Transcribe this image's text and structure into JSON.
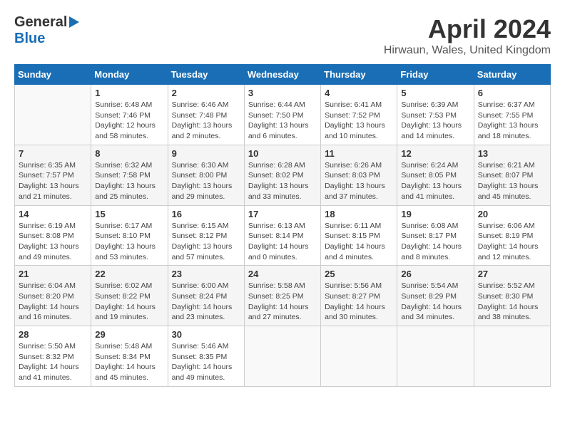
{
  "header": {
    "logo_general": "General",
    "logo_blue": "Blue",
    "month_title": "April 2024",
    "location": "Hirwaun, Wales, United Kingdom"
  },
  "days_of_week": [
    "Sunday",
    "Monday",
    "Tuesday",
    "Wednesday",
    "Thursday",
    "Friday",
    "Saturday"
  ],
  "weeks": [
    [
      {
        "day": "",
        "sunrise": "",
        "sunset": "",
        "daylight": ""
      },
      {
        "day": "1",
        "sunrise": "Sunrise: 6:48 AM",
        "sunset": "Sunset: 7:46 PM",
        "daylight": "Daylight: 12 hours and 58 minutes."
      },
      {
        "day": "2",
        "sunrise": "Sunrise: 6:46 AM",
        "sunset": "Sunset: 7:48 PM",
        "daylight": "Daylight: 13 hours and 2 minutes."
      },
      {
        "day": "3",
        "sunrise": "Sunrise: 6:44 AM",
        "sunset": "Sunset: 7:50 PM",
        "daylight": "Daylight: 13 hours and 6 minutes."
      },
      {
        "day": "4",
        "sunrise": "Sunrise: 6:41 AM",
        "sunset": "Sunset: 7:52 PM",
        "daylight": "Daylight: 13 hours and 10 minutes."
      },
      {
        "day": "5",
        "sunrise": "Sunrise: 6:39 AM",
        "sunset": "Sunset: 7:53 PM",
        "daylight": "Daylight: 13 hours and 14 minutes."
      },
      {
        "day": "6",
        "sunrise": "Sunrise: 6:37 AM",
        "sunset": "Sunset: 7:55 PM",
        "daylight": "Daylight: 13 hours and 18 minutes."
      }
    ],
    [
      {
        "day": "7",
        "sunrise": "Sunrise: 6:35 AM",
        "sunset": "Sunset: 7:57 PM",
        "daylight": "Daylight: 13 hours and 21 minutes."
      },
      {
        "day": "8",
        "sunrise": "Sunrise: 6:32 AM",
        "sunset": "Sunset: 7:58 PM",
        "daylight": "Daylight: 13 hours and 25 minutes."
      },
      {
        "day": "9",
        "sunrise": "Sunrise: 6:30 AM",
        "sunset": "Sunset: 8:00 PM",
        "daylight": "Daylight: 13 hours and 29 minutes."
      },
      {
        "day": "10",
        "sunrise": "Sunrise: 6:28 AM",
        "sunset": "Sunset: 8:02 PM",
        "daylight": "Daylight: 13 hours and 33 minutes."
      },
      {
        "day": "11",
        "sunrise": "Sunrise: 6:26 AM",
        "sunset": "Sunset: 8:03 PM",
        "daylight": "Daylight: 13 hours and 37 minutes."
      },
      {
        "day": "12",
        "sunrise": "Sunrise: 6:24 AM",
        "sunset": "Sunset: 8:05 PM",
        "daylight": "Daylight: 13 hours and 41 minutes."
      },
      {
        "day": "13",
        "sunrise": "Sunrise: 6:21 AM",
        "sunset": "Sunset: 8:07 PM",
        "daylight": "Daylight: 13 hours and 45 minutes."
      }
    ],
    [
      {
        "day": "14",
        "sunrise": "Sunrise: 6:19 AM",
        "sunset": "Sunset: 8:08 PM",
        "daylight": "Daylight: 13 hours and 49 minutes."
      },
      {
        "day": "15",
        "sunrise": "Sunrise: 6:17 AM",
        "sunset": "Sunset: 8:10 PM",
        "daylight": "Daylight: 13 hours and 53 minutes."
      },
      {
        "day": "16",
        "sunrise": "Sunrise: 6:15 AM",
        "sunset": "Sunset: 8:12 PM",
        "daylight": "Daylight: 13 hours and 57 minutes."
      },
      {
        "day": "17",
        "sunrise": "Sunrise: 6:13 AM",
        "sunset": "Sunset: 8:14 PM",
        "daylight": "Daylight: 14 hours and 0 minutes."
      },
      {
        "day": "18",
        "sunrise": "Sunrise: 6:11 AM",
        "sunset": "Sunset: 8:15 PM",
        "daylight": "Daylight: 14 hours and 4 minutes."
      },
      {
        "day": "19",
        "sunrise": "Sunrise: 6:08 AM",
        "sunset": "Sunset: 8:17 PM",
        "daylight": "Daylight: 14 hours and 8 minutes."
      },
      {
        "day": "20",
        "sunrise": "Sunrise: 6:06 AM",
        "sunset": "Sunset: 8:19 PM",
        "daylight": "Daylight: 14 hours and 12 minutes."
      }
    ],
    [
      {
        "day": "21",
        "sunrise": "Sunrise: 6:04 AM",
        "sunset": "Sunset: 8:20 PM",
        "daylight": "Daylight: 14 hours and 16 minutes."
      },
      {
        "day": "22",
        "sunrise": "Sunrise: 6:02 AM",
        "sunset": "Sunset: 8:22 PM",
        "daylight": "Daylight: 14 hours and 19 minutes."
      },
      {
        "day": "23",
        "sunrise": "Sunrise: 6:00 AM",
        "sunset": "Sunset: 8:24 PM",
        "daylight": "Daylight: 14 hours and 23 minutes."
      },
      {
        "day": "24",
        "sunrise": "Sunrise: 5:58 AM",
        "sunset": "Sunset: 8:25 PM",
        "daylight": "Daylight: 14 hours and 27 minutes."
      },
      {
        "day": "25",
        "sunrise": "Sunrise: 5:56 AM",
        "sunset": "Sunset: 8:27 PM",
        "daylight": "Daylight: 14 hours and 30 minutes."
      },
      {
        "day": "26",
        "sunrise": "Sunrise: 5:54 AM",
        "sunset": "Sunset: 8:29 PM",
        "daylight": "Daylight: 14 hours and 34 minutes."
      },
      {
        "day": "27",
        "sunrise": "Sunrise: 5:52 AM",
        "sunset": "Sunset: 8:30 PM",
        "daylight": "Daylight: 14 hours and 38 minutes."
      }
    ],
    [
      {
        "day": "28",
        "sunrise": "Sunrise: 5:50 AM",
        "sunset": "Sunset: 8:32 PM",
        "daylight": "Daylight: 14 hours and 41 minutes."
      },
      {
        "day": "29",
        "sunrise": "Sunrise: 5:48 AM",
        "sunset": "Sunset: 8:34 PM",
        "daylight": "Daylight: 14 hours and 45 minutes."
      },
      {
        "day": "30",
        "sunrise": "Sunrise: 5:46 AM",
        "sunset": "Sunset: 8:35 PM",
        "daylight": "Daylight: 14 hours and 49 minutes."
      },
      {
        "day": "",
        "sunrise": "",
        "sunset": "",
        "daylight": ""
      },
      {
        "day": "",
        "sunrise": "",
        "sunset": "",
        "daylight": ""
      },
      {
        "day": "",
        "sunrise": "",
        "sunset": "",
        "daylight": ""
      },
      {
        "day": "",
        "sunrise": "",
        "sunset": "",
        "daylight": ""
      }
    ]
  ]
}
